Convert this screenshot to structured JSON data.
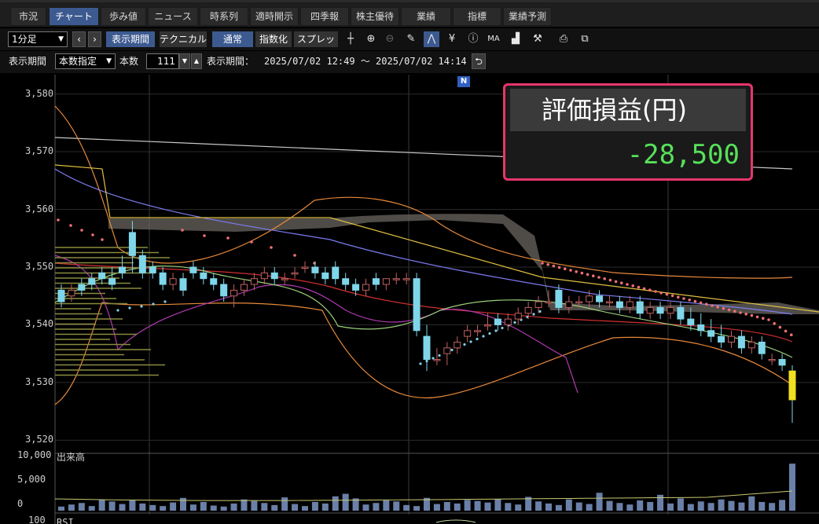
{
  "tabs": [
    "市況",
    "チャート",
    "歩み値",
    "ニュース",
    "時系列",
    "適時開示",
    "四季報",
    "株主優待",
    "業績",
    "指標",
    "業績予測"
  ],
  "active_tab": "チャート",
  "toolbar": {
    "interval": "1分足",
    "display_period_btn": "表示期間",
    "technical_btn": "テクニカル",
    "normal_btn": "通常",
    "index_btn": "指数化",
    "spread_btn": "スプレッド"
  },
  "period_bar": {
    "label": "表示期間",
    "mode": "本数指定",
    "count_label": "本数",
    "count_value": "111",
    "range_label": "表示期間：",
    "range_text": "2025/07/02 12:49 ～ 2025/07/02 14:14"
  },
  "news_badge": "N",
  "pnl_panel": {
    "title": "評価損益(円)",
    "value": "-28,500"
  },
  "chart_data": {
    "type": "candlestick",
    "price_axis": {
      "ticks": [
        "3,580",
        "3,570",
        "3,560",
        "3,550",
        "3,540",
        "3,530",
        "3,520"
      ],
      "range": [
        3518,
        3582
      ]
    },
    "volume_axis": {
      "label": "出来高",
      "ticks": [
        "10,000",
        "5,000",
        "0"
      ]
    },
    "rsi_label": "RSI",
    "rsi_tick": "100",
    "candles": [
      [
        3546,
        3547,
        3543,
        3544
      ],
      [
        3545,
        3547,
        3544,
        3546
      ],
      [
        3547,
        3548,
        3545,
        3546
      ],
      [
        3548,
        3549,
        3546,
        3547
      ],
      [
        3549,
        3550,
        3547,
        3548
      ],
      [
        3548,
        3550,
        3546,
        3547
      ],
      [
        3550,
        3552,
        3548,
        3549
      ],
      [
        3556,
        3558,
        3549,
        3552
      ],
      [
        3552,
        3553,
        3548,
        3549
      ],
      [
        3550,
        3551,
        3548,
        3549
      ],
      [
        3549,
        3550,
        3546,
        3547
      ],
      [
        3547,
        3549,
        3546,
        3548
      ],
      [
        3548,
        3549,
        3545,
        3546
      ],
      [
        3550,
        3551,
        3548,
        3549
      ],
      [
        3549,
        3550,
        3547,
        3548
      ],
      [
        3548,
        3549,
        3546,
        3547
      ],
      [
        3547,
        3548,
        3544,
        3545
      ],
      [
        3545,
        3547,
        3543,
        3546
      ],
      [
        3546,
        3548,
        3545,
        3547
      ],
      [
        3547,
        3549,
        3546,
        3548
      ],
      [
        3548,
        3550,
        3547,
        3549
      ],
      [
        3549,
        3550,
        3547,
        3548
      ],
      [
        3548,
        3549,
        3547,
        3548
      ],
      [
        3549,
        3550,
        3548,
        3549
      ],
      [
        3550,
        3551,
        3549,
        3550
      ],
      [
        3550,
        3551,
        3548,
        3549
      ],
      [
        3549,
        3550,
        3547,
        3548
      ],
      [
        3550,
        3551,
        3547,
        3548
      ],
      [
        3548,
        3549,
        3546,
        3547
      ],
      [
        3547,
        3548,
        3545,
        3546
      ],
      [
        3546,
        3548,
        3545,
        3547
      ],
      [
        3548,
        3549,
        3546,
        3547
      ],
      [
        3547,
        3548,
        3546,
        3548
      ],
      [
        3548,
        3549,
        3547,
        3548
      ],
      [
        3548,
        3549,
        3547,
        3548
      ],
      [
        3548,
        3549,
        3538,
        3539
      ],
      [
        3538,
        3540,
        3532,
        3534
      ],
      [
        3534,
        3536,
        3533,
        3534
      ],
      [
        3535,
        3537,
        3533,
        3536
      ],
      [
        3536,
        3538,
        3535,
        3537
      ],
      [
        3538,
        3540,
        3537,
        3539
      ],
      [
        3539,
        3540,
        3538,
        3539
      ],
      [
        3540,
        3542,
        3539,
        3540
      ],
      [
        3541,
        3542,
        3539,
        3540
      ],
      [
        3540,
        3542,
        3539,
        3541
      ],
      [
        3541,
        3543,
        3540,
        3542
      ],
      [
        3542,
        3544,
        3541,
        3543
      ],
      [
        3543,
        3545,
        3542,
        3544
      ],
      [
        3544,
        3546,
        3543,
        3544
      ],
      [
        3546,
        3547,
        3542,
        3543
      ],
      [
        3543,
        3545,
        3542,
        3544
      ],
      [
        3544,
        3545,
        3543,
        3544
      ],
      [
        3544,
        3546,
        3543,
        3545
      ],
      [
        3545,
        3546,
        3543,
        3544
      ],
      [
        3544,
        3545,
        3543,
        3544
      ],
      [
        3544,
        3545,
        3542,
        3543
      ],
      [
        3543,
        3545,
        3542,
        3544
      ],
      [
        3544,
        3545,
        3541,
        3542
      ],
      [
        3542,
        3544,
        3541,
        3543
      ],
      [
        3543,
        3544,
        3541,
        3542
      ],
      [
        3542,
        3544,
        3541,
        3543
      ],
      [
        3543,
        3544,
        3540,
        3541
      ],
      [
        3541,
        3543,
        3539,
        3540
      ],
      [
        3540,
        3542,
        3538,
        3539
      ],
      [
        3539,
        3541,
        3537,
        3538
      ],
      [
        3538,
        3540,
        3536,
        3537
      ],
      [
        3537,
        3539,
        3536,
        3538
      ],
      [
        3538,
        3539,
        3535,
        3536
      ],
      [
        3536,
        3538,
        3535,
        3537
      ],
      [
        3537,
        3538,
        3534,
        3535
      ],
      [
        3534,
        3535,
        3533,
        3534
      ],
      [
        3534,
        3535,
        3532,
        3533
      ],
      [
        3532,
        3533,
        3523,
        3527
      ]
    ],
    "volumes": [
      800,
      1200,
      1500,
      900,
      2100,
      1800,
      1300,
      2000,
      1400,
      1100,
      900,
      1600,
      2500,
      1200,
      1700,
      1000,
      800,
      1400,
      2200,
      1900,
      1500,
      1100,
      2600,
      1300,
      900,
      1700,
      1400,
      2800,
      3300,
      2400,
      1200,
      1500,
      2000,
      1800,
      1100,
      900,
      2500,
      1300,
      1700,
      1400,
      2100,
      1900,
      1600,
      2300,
      1500,
      1200,
      2700,
      1800,
      1400,
      1100,
      2200,
      1600,
      1300,
      3500,
      1900,
      1500,
      1200,
      2000,
      1700,
      3100,
      1400,
      2400,
      1300,
      1800,
      1500,
      2200,
      1900,
      1600,
      2800,
      1700,
      1500,
      2100,
      9200
    ]
  }
}
